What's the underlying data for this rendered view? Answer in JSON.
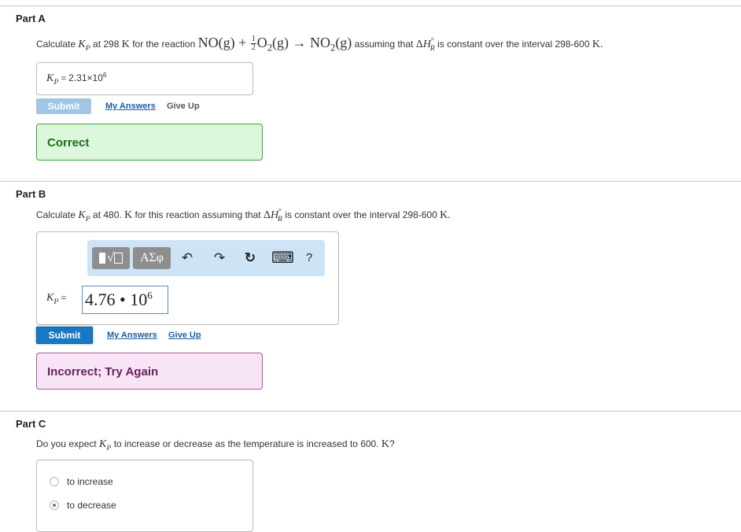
{
  "partA": {
    "title": "Part A",
    "q_prefix": "Calculate ",
    "q_at": " at 298 ",
    "q_reaction_text": " for the reaction ",
    "q_assuming": " assuming that ",
    "q_constant": " is constant over the interval 298-600 ",
    "answer_label": "= ",
    "answer_mantissa": "2.31×10",
    "answer_exp": "6",
    "submit_label": "Submit",
    "my_answers_label": "My Answers",
    "give_up_label": "Give Up",
    "feedback": "Correct"
  },
  "partB": {
    "title": "Part B",
    "q_prefix": "Calculate ",
    "q_at": " at 480. ",
    "q_rest": " for this reaction assuming that ",
    "q_constant": " is constant over the interval 298-600 ",
    "answer_label": "= ",
    "answer_mantissa": "4.76 • 10",
    "answer_exp": "6",
    "toolbar": {
      "sqrt_label": "√",
      "greek_label": "ΑΣφ",
      "undo": "↶",
      "redo": "↷",
      "reset": "↻",
      "keyboard": "⌨",
      "help": "?"
    },
    "submit_label": "Submit",
    "my_answers_label": "My Answers",
    "give_up_label": "Give Up",
    "feedback": "Incorrect; Try Again"
  },
  "partC": {
    "title": "Part C",
    "q_prefix": "Do you expect ",
    "q_mid": " to increase or decrease as the temperature is increased to 600. ",
    "q_end": "?",
    "options": [
      {
        "label": "to increase",
        "selected": false
      },
      {
        "label": "to decrease",
        "selected": true
      }
    ]
  },
  "colors": {
    "correct_bg": "#dcf7dc",
    "correct_border": "#3fa33f",
    "correct_text": "#1d6a1d",
    "incorrect_bg": "#f7e4f5",
    "incorrect_border": "#a95ea0",
    "incorrect_text": "#6a2060",
    "submit_active": "#1a78c2",
    "submit_disabled": "#9fc7e5",
    "link": "#1c5fa3"
  }
}
